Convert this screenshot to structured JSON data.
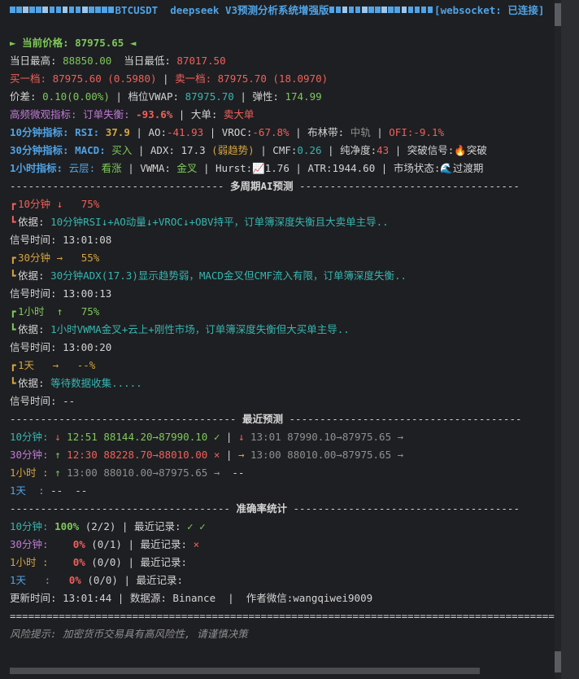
{
  "header": {
    "symbol": "BTCUSDT",
    "title": "deepseek V3预测分析系统增强版",
    "ws_status": "[websocket: 已连接]"
  },
  "price": {
    "arrow_left": "►",
    "label": "当前价格:",
    "value": "87975.65",
    "arrow_right": "◄"
  },
  "range": {
    "high_label": "当日最高:",
    "high": "88850.00",
    "low_label": "当日最低:",
    "low": "87017.50"
  },
  "book": {
    "bid_label": "买一档:",
    "bid": "87975.60 (0.5980)",
    "ask_label": "卖一档:",
    "ask": "87975.70 (18.0970)"
  },
  "spread": {
    "diff_label": "价差:",
    "diff": "0.10(0.00%)",
    "vwap_label": "档位VWAP:",
    "vwap": "87975.70",
    "elastic_label": "弹性:",
    "elastic": "174.99"
  },
  "hf": {
    "label": "高频微观指标:",
    "imbalance_label": "订单失衡:",
    "imbalance": "-93.6%",
    "bigorder_label": "大单:",
    "bigorder": "卖大单"
  },
  "ind10": {
    "label": "10分钟指标:",
    "rsi_label": "RSI:",
    "rsi": "37.9",
    "ao_label": "AO:",
    "ao": "-41.93",
    "vroc_label": "VROC:",
    "vroc": "-67.8%",
    "boll_label": "布林带:",
    "boll": "中轨",
    "ofi": "OFI:-9.1%"
  },
  "ind30": {
    "label": "30分钟指标:",
    "macd_label": "MACD:",
    "macd": "买入",
    "adx_label": "ADX:",
    "adx": "17.3",
    "adx_trend": "(弱趋势)",
    "cmf_label": "CMF:",
    "cmf": "0.26",
    "purity_label": "纯净度:",
    "purity": "43",
    "breakout_label": "突破信号:",
    "breakout": "突破",
    "breakout_icon": "🔥"
  },
  "ind1h": {
    "label": "1小时指标:",
    "cloud_label": "云层:",
    "cloud": "看涨",
    "vwma_label": "VWMA:",
    "vwma": "金叉",
    "hurst_label": "Hurst:",
    "hurst": "1.76",
    "hurst_icon": "📈",
    "atr_label": "ATR:",
    "atr": "1944.60",
    "market_label": "市场状态:",
    "market": "过渡期",
    "market_icon": "🌊"
  },
  "sections": {
    "multi": "多周期AI预测",
    "recent": "最近预测",
    "accuracy": "准确率统计"
  },
  "predictions": [
    {
      "period": "10分钟",
      "dir": "↓",
      "pct": "75%",
      "basis_label": "依据:",
      "basis": "10分钟RSI↓+AO动量↓+VROC↓+OBV持平，订单簿深度失衡且大卖单主导..",
      "time_label": "信号时间:",
      "time": "13:01:08"
    },
    {
      "period": "30分钟",
      "dir": "→",
      "pct": "55%",
      "basis_label": "依据:",
      "basis": "30分钟ADX(17.3)显示趋势弱，MACD金叉但CMF流入有限，订单簿深度失衡..",
      "time_label": "信号时间:",
      "time": "13:00:13"
    },
    {
      "period": "1小时",
      "dir": "↑",
      "pct": "75%",
      "basis_label": "依据:",
      "basis": "1小时VWMA金叉+云上+刚性市场，订单簿深度失衡但大买单主导..",
      "time_label": "信号时间:",
      "time": "13:00:20"
    },
    {
      "period": "1天",
      "dir": "→",
      "pct": "--%",
      "basis_label": "依据:",
      "basis": "等待数据收集.....",
      "time_label": "信号时间:",
      "time": "--"
    }
  ],
  "recent": [
    {
      "label": "10分钟:",
      "e1_dir": "↓",
      "e1_time": "12:51",
      "e1_prices": "88144.20→87990.10",
      "e1_mark": "✓",
      "e2_dir": "↓",
      "e2_time": "13:01",
      "e2_prices": "87990.10→87975.65",
      "e2_mark": "→"
    },
    {
      "label": "30分钟:",
      "e1_dir": "↑",
      "e1_time": "12:30",
      "e1_prices": "88228.70→88010.00",
      "e1_mark": "×",
      "e2_dir": "→",
      "e2_time": "13:00",
      "e2_prices": "88010.00→87975.65",
      "e2_mark": "→"
    },
    {
      "label": "1小时 :",
      "e1_dir": "↑",
      "e1_time": "13:00",
      "e1_prices": "88010.00→87975.65",
      "e1_mark": "→",
      "e2_dir": "",
      "e2_time": "",
      "e2_prices": "--",
      "e2_mark": ""
    },
    {
      "label": "1天  :",
      "e1_dir": "",
      "e1_time": "",
      "e1_prices": "--",
      "e1_mark": "",
      "e2_dir": "",
      "e2_time": "",
      "e2_prices": "--",
      "e2_mark": ""
    }
  ],
  "accuracy": [
    {
      "label": "10分钟:",
      "pct": "100%",
      "count": "(2/2)",
      "rec_label": "最近记录:",
      "rec": "✓ ✓"
    },
    {
      "label": "30分钟:",
      "pct": "0%",
      "count": "(0/1)",
      "rec_label": "最近记录:",
      "rec": "×"
    },
    {
      "label": "1小时 :",
      "pct": "0%",
      "count": "(0/0)",
      "rec_label": "最近记录:",
      "rec": ""
    },
    {
      "label": "1天   :",
      "pct": "0%",
      "count": "(0/0)",
      "rec_label": "最近记录:",
      "rec": ""
    }
  ],
  "footer": {
    "update_label": "更新时间:",
    "update_time": "13:01:44",
    "source_label": "数据源:",
    "source": "Binance",
    "author_label": "作者微信:",
    "author": "wangqiwei9009",
    "risk": "风险提示: 加密货币交易具有高风险性, 请谨慎决策"
  },
  "colors": {
    "background": "#1e1f22",
    "green": "#7ec85a",
    "red": "#f0605a",
    "cyan": "#36b6b0",
    "blue": "#4fa3e6",
    "magenta": "#c07ad6",
    "yellow": "#d5a441"
  }
}
